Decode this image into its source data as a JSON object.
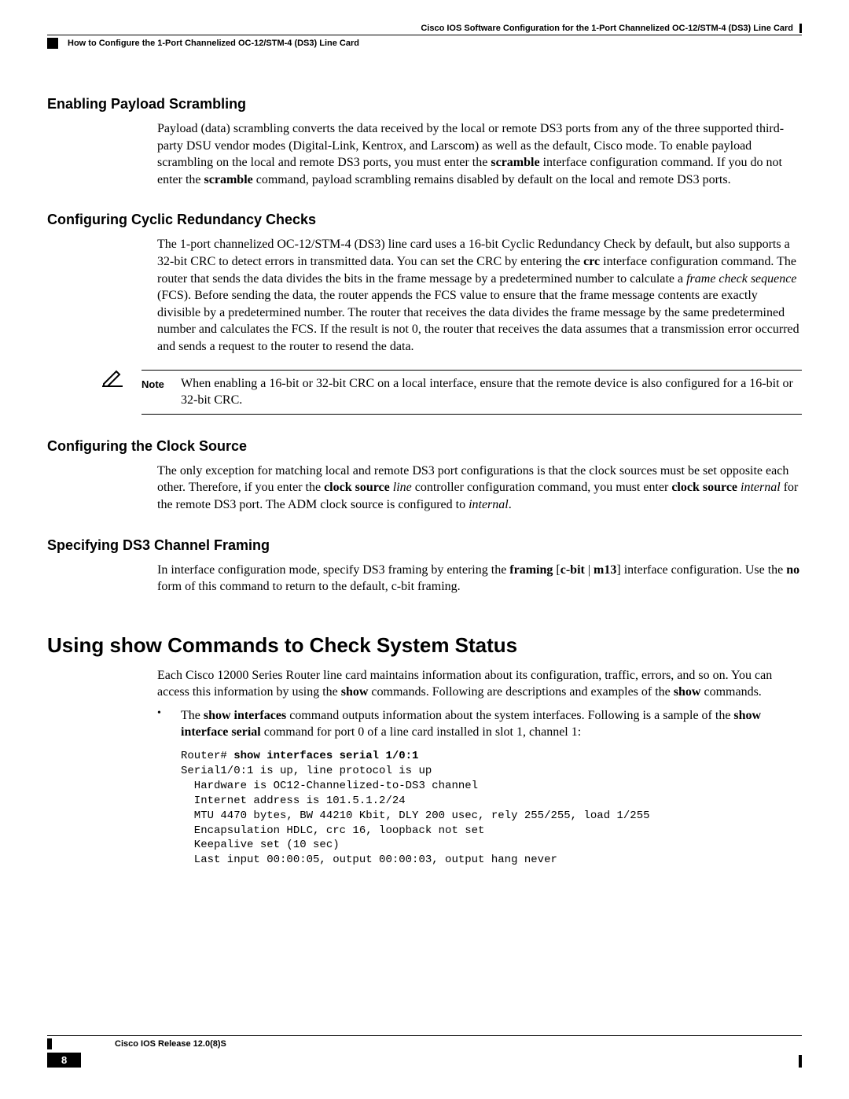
{
  "header": {
    "doc_title": "Cisco IOS Software Configuration for the 1-Port Channelized OC-12/STM-4 (DS3) Line Card",
    "breadcrumb": "How to Configure the 1-Port Channelized OC-12/STM-4 (DS3) Line Card"
  },
  "sections": {
    "s1": {
      "heading": "Enabling Payload Scrambling",
      "p1a": "Payload (data) scrambling converts the data received by the local or remote DS3 ports from any of the three supported third-party DSU vendor modes (Digital-Link, Kentrox, and Larscom) as well as the default, Cisco mode. To enable payload scrambling on the local and remote DS3 ports, you must enter the ",
      "p1b": "scramble",
      "p1c": " interface configuration command. If you do not enter the ",
      "p1d": "scramble",
      "p1e": " command, payload scrambling remains disabled by default on the local and remote DS3 ports."
    },
    "s2": {
      "heading": "Configuring Cyclic Redundancy Checks",
      "p1a": "The 1-port channelized OC-12/STM-4 (DS3) line card uses a 16-bit Cyclic Redundancy Check by default, but also supports a 32-bit CRC to detect errors in transmitted data. You can set the CRC by entering the ",
      "p1b": "crc",
      "p1c": " interface configuration command. The router that sends the data divides the bits in the frame message by a predetermined number to calculate a ",
      "p1d": "frame check sequence",
      "p1e": " (FCS). Before sending the data, the router appends the FCS value to ensure that the frame message contents are exactly divisible by a predetermined number. The router that receives the data divides the frame message by the same predetermined number and calculates the FCS. If the result is not 0, the router that receives the data assumes that a transmission error occurred and sends a request to the router to resend the data.",
      "note_label": "Note",
      "note_text": "When enabling a 16-bit or 32-bit CRC on a local interface, ensure that the remote device is also configured for a 16-bit or 32-bit CRC."
    },
    "s3": {
      "heading": "Configuring the Clock Source",
      "p1a": "The only exception for matching local and remote DS3 port configurations is that the clock sources must be set opposite each other. Therefore, if you enter the ",
      "p1b": "clock source",
      "p1c": " ",
      "p1d": "line",
      "p1e": " controller configuration command, you must enter ",
      "p1f": "clock source",
      "p1g": " ",
      "p1h": "internal",
      "p1i": " for the remote DS3 port. The ADM clock source is configured to ",
      "p1j": "internal",
      "p1k": "."
    },
    "s4": {
      "heading": "Specifying DS3 Channel Framing",
      "p1a": "In interface configuration mode, specify DS3 framing by entering the ",
      "p1b": "framing",
      "p1c": " [",
      "p1d": "c-bit",
      "p1e": " | ",
      "p1f": "m13",
      "p1g": "] interface configuration. Use the ",
      "p1h": "no",
      "p1i": " form of this command to return to the default, c-bit framing."
    },
    "s5": {
      "heading": "Using show Commands to Check System Status",
      "p1a": "Each Cisco 12000 Series Router line card maintains information about its configuration, traffic, errors, and so on. You can access this information by using the ",
      "p1b": "show",
      "p1c": " commands. Following are descriptions and examples of the ",
      "p1d": "show",
      "p1e": " commands.",
      "b1a": "The ",
      "b1b": "show interfaces",
      "b1c": " command outputs information about the system interfaces. Following is a sample of the ",
      "b1d": "show interface serial",
      "b1e": " command for port 0 of a line card installed in slot 1, channel 1:",
      "code_prompt": "Router# ",
      "code_cmd": "show interfaces serial 1/0:1",
      "code_body": "Serial1/0:1 is up, line protocol is up\n  Hardware is OC12-Channelized-to-DS3 channel\n  Internet address is 101.5.1.2/24\n  MTU 4470 bytes, BW 44210 Kbit, DLY 200 usec, rely 255/255, load 1/255\n  Encapsulation HDLC, crc 16, loopback not set\n  Keepalive set (10 sec)\n  Last input 00:00:05, output 00:00:03, output hang never"
    }
  },
  "footer": {
    "release": "Cisco IOS Release 12.0(8)S",
    "page": "8"
  }
}
